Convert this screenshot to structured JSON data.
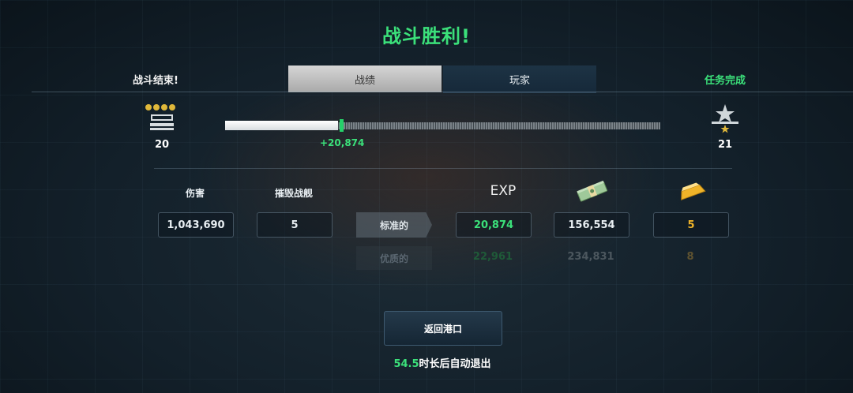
{
  "title": "战斗胜利!",
  "header": {
    "left_text": "战斗结束!",
    "tabs": [
      {
        "label": "战绩",
        "active": true
      },
      {
        "label": "玩家",
        "active": false
      }
    ],
    "right_text": "任务完成"
  },
  "rank": {
    "current_level": "20",
    "next_level": "21",
    "progress": 0.26,
    "xp_gain": "+20,874",
    "current_icon": "rank-insignia-4-stars-icon",
    "next_icon": "rank-insignia-star-icon"
  },
  "stats": {
    "damage_label": "伤害",
    "damage_value": "1,043,690",
    "kills_label": "摧毁战舰",
    "kills_value": "5"
  },
  "rewards": {
    "exp_label": "EXP",
    "credits_icon": "cash-bundle-icon",
    "gold_icon": "gold-bar-icon",
    "standard": {
      "label": "标准的",
      "exp": "20,874",
      "credits": "156,554",
      "gold": "5"
    },
    "premium": {
      "label": "优质的",
      "exp": "22,961",
      "credits": "234,831",
      "gold": "8"
    }
  },
  "actions": {
    "return_label": "返回港口"
  },
  "auto_exit": {
    "seconds": "54.5",
    "text": "时长后自动退出"
  },
  "colors": {
    "accent_green": "#3be07a",
    "gold": "#f0b429"
  }
}
